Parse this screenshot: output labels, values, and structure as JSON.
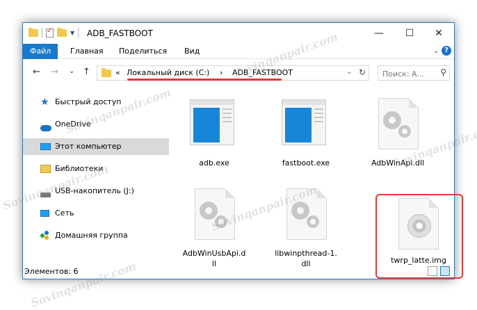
{
  "window": {
    "title": "ADB_FASTBOOT",
    "controls": {
      "minimize": "—",
      "maximize": "☐",
      "close": "✕"
    }
  },
  "ribbon": {
    "tabs": [
      {
        "label": "Файл",
        "active": true
      },
      {
        "label": "Главная"
      },
      {
        "label": "Поделиться"
      },
      {
        "label": "Вид"
      }
    ],
    "help_label": "?"
  },
  "nav": {
    "back": "←",
    "forward": "→",
    "recent": "⌄",
    "up": "↑"
  },
  "address": {
    "prefix": "«",
    "segments": [
      "Локальный диск (C:)",
      "ADB_FASTBOOT"
    ],
    "separator": "›",
    "dropdown": "⌄",
    "refresh": "↻"
  },
  "search": {
    "placeholder": "Поиск: A...",
    "icon": "search-icon"
  },
  "sidebar": {
    "items": [
      {
        "label": "Быстрый доступ",
        "icon": "star-icon"
      },
      {
        "label": "OneDrive",
        "icon": "cloud-icon"
      },
      {
        "label": "Этот компьютер",
        "icon": "computer-icon",
        "selected": true
      },
      {
        "label": "Библиотеки",
        "icon": "library-icon"
      },
      {
        "label": "USB-накопитель (J:)",
        "icon": "usb-drive-icon"
      },
      {
        "label": "Сеть",
        "icon": "network-icon"
      },
      {
        "label": "Домашняя группа",
        "icon": "homegroup-icon"
      }
    ]
  },
  "files": [
    {
      "name": "adb.exe",
      "type": "exe"
    },
    {
      "name": "fastboot.exe",
      "type": "exe"
    },
    {
      "name": "AdbWinApi.dll",
      "type": "dll"
    },
    {
      "name_line1": "AdbWinUsbApi.d",
      "name_line2": "ll",
      "type": "dll"
    },
    {
      "name_line1": "libwinpthread-1.",
      "name_line2": "dll",
      "type": "dll"
    },
    {
      "name": "twrp_latte.img",
      "type": "img",
      "highlighted": true
    }
  ],
  "status": {
    "items_text": "Элементов: 6"
  },
  "watermark": {
    "text": "Sovinqanpair.com"
  },
  "colors": {
    "accent": "#1979ca",
    "highlight": "#e53935",
    "folder": "#f2c94c"
  }
}
